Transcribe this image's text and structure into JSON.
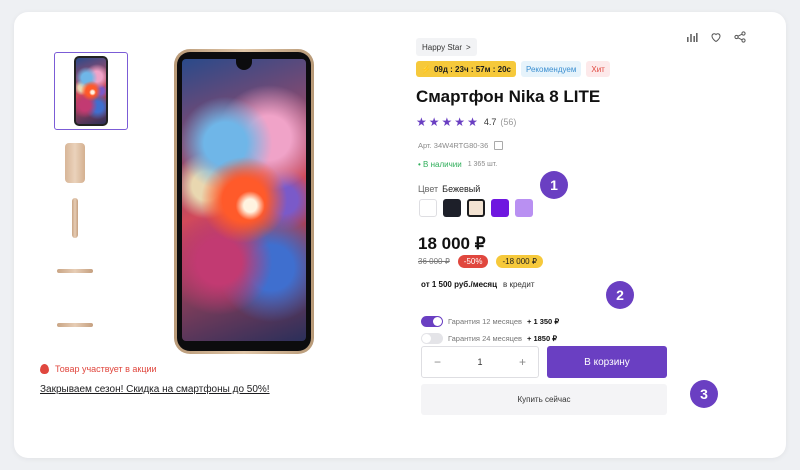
{
  "gallery": {
    "thumbnails": [
      "phone-front",
      "phone-back",
      "phone-side",
      "phone-bottom",
      "phone-top"
    ]
  },
  "promo": {
    "badge_text": "Товар участвует в акции",
    "link_text": "Закрываем сезон! Скидка на смартфоны до 50%!"
  },
  "product": {
    "brand": "Happy Star",
    "brand_chevron": ">",
    "timer": "09д : 23ч : 57м : 20с",
    "badge_recommended": "Рекомендуем",
    "badge_hit": "Хит",
    "title": "Смартфон Nika 8 LITE",
    "rating_value": "4.7",
    "rating_count": "(56)",
    "stars": 5,
    "sku": "Арт. 34W4RTG80-36",
    "stock_status": "• В наличии",
    "stock_qty": "1 365 шт.",
    "color_label": "Цвет",
    "color_selected": "Бежевый",
    "colors": [
      "#ffffff",
      "#1d1f29",
      "#f3e3d2",
      "#6f17e0",
      "#b990f2"
    ],
    "price": "18 000 ₽",
    "old_price": "36 000 ₽",
    "discount_percent": "-50%",
    "discount_amount": "-18 000 ₽",
    "credit_amount": "от 1 500 руб./месяц",
    "credit_label": "в кредит",
    "guarantees": [
      {
        "label": "Гарантия 12 месяцев",
        "price": "+ 1 350 ₽",
        "on": true
      },
      {
        "label": "Гарантия 24 месяцев",
        "price": "+ 1850 ₽",
        "on": false
      }
    ],
    "quantity": "1",
    "minus": "−",
    "plus": "+",
    "add_to_cart": "В корзину",
    "buy_now": "Купить сейчас"
  },
  "markers": [
    "1",
    "2",
    "3"
  ],
  "accent_color": "#6a3fc2"
}
